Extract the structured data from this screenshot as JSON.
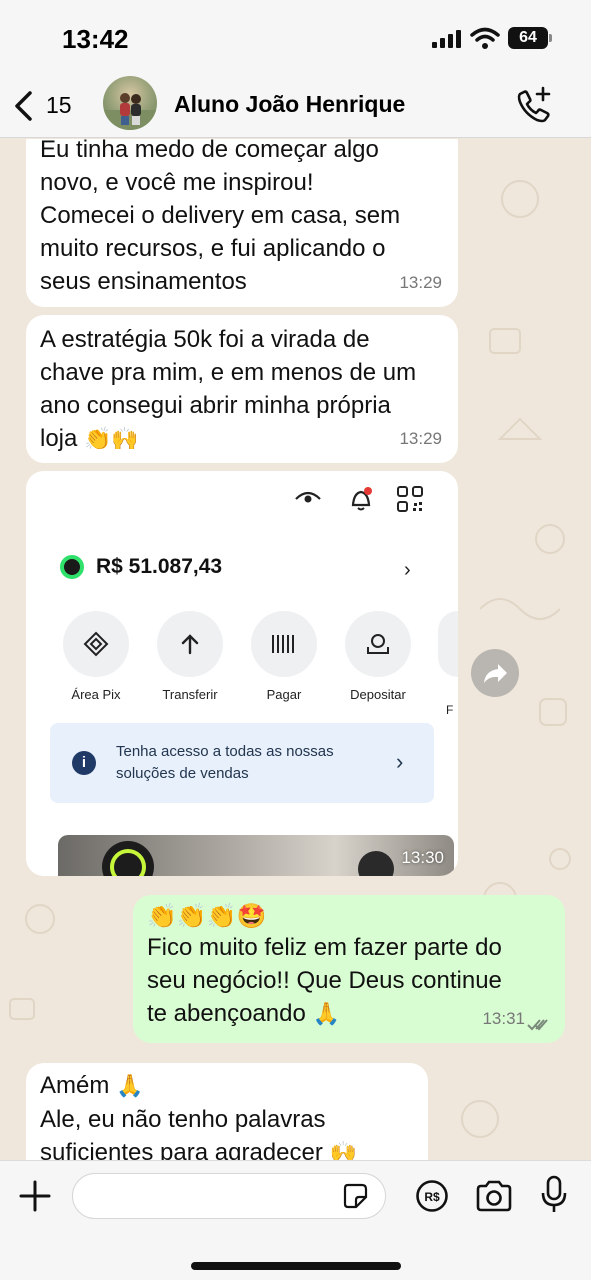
{
  "status_bar": {
    "time": "13:42",
    "battery": "64"
  },
  "header": {
    "unread": "15",
    "contact_name": "Aluno João Henrique"
  },
  "messages": [
    {
      "direction": "in",
      "text": "Eu tinha medo de começar algo\nnovo, e você me inspirou!\nComecei o delivery em casa, sem\nmuito recursos, e fui aplicando o\nseus ensinamentos",
      "time": "13:29"
    },
    {
      "direction": "in",
      "text": "A estratégia 50k foi a virada de\nchave pra mim, e em menos de um\nano consegui abrir minha própria\nloja",
      "emoji": "👏🙌",
      "time": "13:29"
    },
    {
      "direction": "in",
      "type": "image",
      "time": "13:30"
    },
    {
      "direction": "out",
      "emoji_line": "👏👏👏🤩",
      "text": "Fico muito feliz em fazer parte do\nseu negócio!! Que Deus continue\nte abençoando",
      "emoji": "🙏",
      "time": "13:31",
      "read": true
    },
    {
      "direction": "in",
      "text": "Amém",
      "emoji": "🙏",
      "text2": "Ale, eu não tenho palavras\nsuficientes para agradecer",
      "emoji2": "🙌"
    }
  ],
  "screenshot": {
    "balance": "R$ 51.087,43",
    "actions": [
      {
        "label": "Área Pix",
        "icon": "pix-icon"
      },
      {
        "label": "Transferir",
        "icon": "arrow-up-icon"
      },
      {
        "label": "Pagar",
        "icon": "barcode-icon"
      },
      {
        "label": "Depositar",
        "icon": "deposit-icon"
      }
    ],
    "partial_label": "F",
    "promo_text": "Tenha acesso a todas as nossas\nsoluções de vendas"
  },
  "input": {
    "placeholder": ""
  },
  "colors": {
    "incoming": "#ffffff",
    "outgoing": "#d9fdd3",
    "background": "#efe7dc",
    "pix_green": "#2fe06a"
  }
}
